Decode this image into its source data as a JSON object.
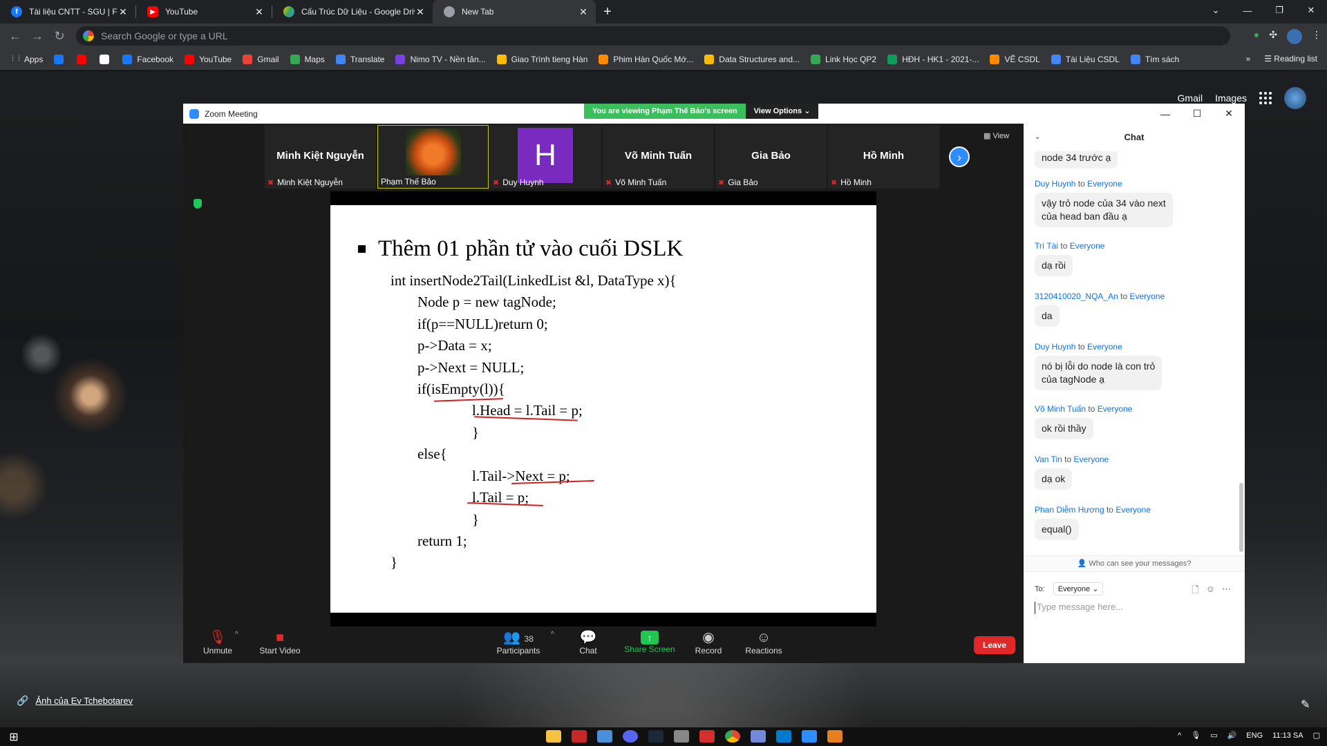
{
  "browser": {
    "tabs": [
      {
        "title": "Tài liệu CNTT - SGU | Facebook",
        "color": "#1877f2",
        "glyph": "f",
        "active": false
      },
      {
        "title": "YouTube",
        "color": "#ff0000",
        "glyph": "▶",
        "active": false
      },
      {
        "title": "Cấu Trúc Dữ Liệu - Google Drive",
        "color": "#fbbc05",
        "glyph": "▲",
        "active": false
      },
      {
        "title": "New Tab",
        "color": "#9aa0a6",
        "glyph": "●",
        "active": true
      }
    ],
    "omnibox_placeholder": "Search Google or type a URL",
    "bookmarks": [
      {
        "label": "Apps",
        "color": "#e8eaed"
      },
      {
        "label": "",
        "color": "#1877f2"
      },
      {
        "label": "",
        "color": "#ff0000"
      },
      {
        "label": "",
        "color": "#ffffff"
      },
      {
        "label": "Facebook",
        "color": "#1877f2"
      },
      {
        "label": "YouTube",
        "color": "#ff0000"
      },
      {
        "label": "Gmail",
        "color": "#ea4335"
      },
      {
        "label": "Maps",
        "color": "#34a853"
      },
      {
        "label": "Translate",
        "color": "#4285f4"
      },
      {
        "label": "Nimo TV - Nền tản...",
        "color": "#7b3fe4"
      },
      {
        "label": "Giao Trình tieng Hàn",
        "color": "#fbbc05"
      },
      {
        "label": "Phim Hàn Quốc Mớ...",
        "color": "#ff8a00"
      },
      {
        "label": "Data Structures and...",
        "color": "#fbbc05"
      },
      {
        "label": "Link Học QP2",
        "color": "#34a853"
      },
      {
        "label": "HĐH - HK1 - 2021-...",
        "color": "#0f9d58"
      },
      {
        "label": "VẼ CSDL",
        "color": "#ff8a00"
      },
      {
        "label": "Tài Liệu CSDL",
        "color": "#4285f4"
      },
      {
        "label": "Tìm sách",
        "color": "#4285f4"
      }
    ],
    "reading_list": "Reading list",
    "google_links": {
      "gmail": "Gmail",
      "images": "Images"
    }
  },
  "zoom": {
    "window_title": "Zoom Meeting",
    "viewing_banner": "You are viewing Phạm Thế Bảo's screen",
    "view_options": "View Options",
    "view_label": "View",
    "participants_tiles": [
      {
        "big": "Minh Kiệt Nguyễn",
        "small": "Minh Kiệt Nguyễn",
        "muted": true,
        "kind": "name"
      },
      {
        "big": "",
        "small": "Phạm Thế Bảo",
        "muted": false,
        "kind": "photo"
      },
      {
        "big": "H",
        "small": "Duy Huynh",
        "muted": true,
        "kind": "letter"
      },
      {
        "big": "Võ Minh Tuấn",
        "small": "Võ Minh Tuấn",
        "muted": true,
        "kind": "name"
      },
      {
        "big": "Gia Bảo",
        "small": "Gia Bảo",
        "muted": true,
        "kind": "name"
      },
      {
        "big": "Hồ Minh",
        "small": "Hồ Minh",
        "muted": true,
        "kind": "name"
      }
    ],
    "slide": {
      "title": "Thêm 01 phần tử vào cuối DSLK",
      "code": [
        "int insertNode2Tail(LinkedList &l, DataType x){",
        "Node p = new tagNode;",
        "if(p==NULL)return 0;",
        "p->Data = x;",
        "p->Next = NULL;",
        "if(isEmpty(l)){",
        "l.Head = l.Tail = p;",
        "}",
        "else{",
        "l.Tail->Next = p;",
        "l.Tail = p;",
        "}",
        "return 1;",
        "}"
      ]
    },
    "toolbar": {
      "unmute": "Unmute",
      "start_video": "Start Video",
      "participants": "Participants",
      "participants_count": "38",
      "chat": "Chat",
      "share_screen": "Share Screen",
      "record": "Record",
      "reactions": "Reactions",
      "leave": "Leave"
    },
    "chat": {
      "title": "Chat",
      "messages": [
        {
          "sender": "",
          "to": "",
          "text": "node 34 trước ạ"
        },
        {
          "sender": "Duy Huynh",
          "to": "Everyone",
          "text": "vậy trỏ node của 34 vào next\ncủa head ban đầu ạ"
        },
        {
          "sender": "Trí Tài",
          "to": "Everyone",
          "text": "dạ rồi"
        },
        {
          "sender": "3120410020_NQA_An",
          "to": "Everyone",
          "text": "da"
        },
        {
          "sender": "Duy Huynh",
          "to": "Everyone",
          "text": "nó bị lỗi do node là con trỏ\ncủa tagNode ạ"
        },
        {
          "sender": "Võ Minh Tuấn",
          "to": "Everyone",
          "text": "ok rồi thầy"
        },
        {
          "sender": "Van Tin",
          "to": "Everyone",
          "text": "dạ ok"
        },
        {
          "sender": "Phan Diễm Hương",
          "to": "Everyone",
          "text": "equal()"
        }
      ],
      "to_word": "to",
      "who_can_see": "Who can see your messages?",
      "to_label": "To:",
      "recipient": "Everyone",
      "input_placeholder": "Type message here..."
    }
  },
  "desktop": {
    "photo_credit": "Ảnh của Ev Tchebotarev"
  },
  "taskbar": {
    "language": "ENG",
    "time": "11:13 SA"
  }
}
